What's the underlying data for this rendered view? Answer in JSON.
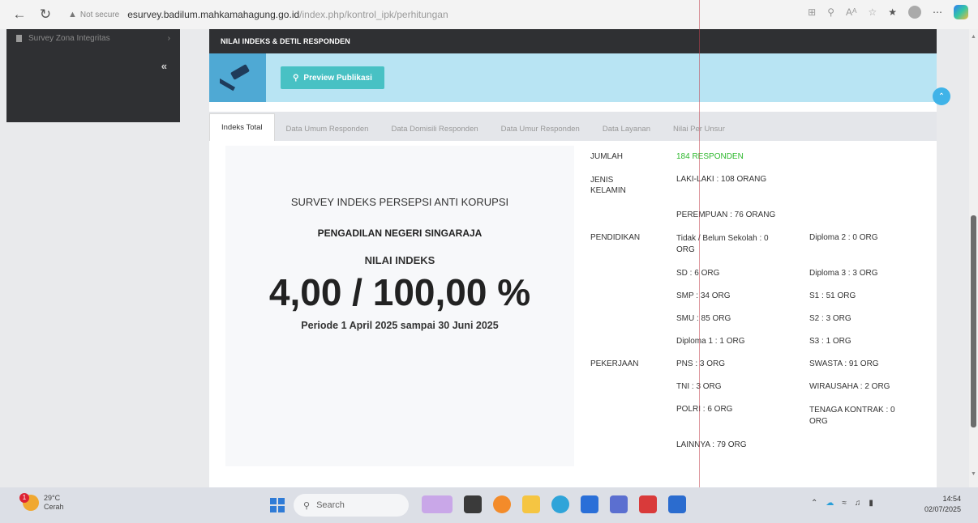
{
  "browser": {
    "security_label": "Not secure",
    "url_host": "esurvey.badilum.mahkamahagung.go.id",
    "url_path": "/index.php/kontrol_ipk/perhitungan",
    "aa_label": "Aᴬ"
  },
  "sidebar": {
    "item_label": "Survey Zona Integritas",
    "collapse_glyph": "«"
  },
  "panel": {
    "title": "NILAI INDEKS & DETIL RESPONDEN",
    "preview_button": "Preview Publikasi"
  },
  "tabs": [
    {
      "label": "Indeks Total",
      "active": true
    },
    {
      "label": "Data Umum Responden",
      "active": false
    },
    {
      "label": "Data Domisili Responden",
      "active": false
    },
    {
      "label": "Data Umur Responden",
      "active": false
    },
    {
      "label": "Data Layanan",
      "active": false
    },
    {
      "label": "Nilai Per Unsur",
      "active": false
    }
  ],
  "index_card": {
    "survey_title": "SURVEY INDEKS PERSEPSI ANTI KORUPSI",
    "court": "PENGADILAN NEGERI SINGARAJA",
    "nilai_label": "NILAI INDEKS",
    "value": "4,00 / 100,00 %",
    "period": "Periode 1 April 2025 sampai 30 Juni 2025"
  },
  "details": {
    "jumlah_label": "JUMLAH",
    "jumlah_value": "184 RESPONDEN",
    "jenis_label": "JENIS KELAMIN",
    "laki": "LAKI-LAKI : 108 ORANG",
    "perempuan": "PEREMPUAN : 76 ORANG",
    "pendidikan_label": "PENDIDIKAN",
    "pendidikan_left": [
      "Tidak / Belum Sekolah : 0 ORG",
      "SD : 6 ORG",
      "SMP : 34 ORG",
      "SMU : 85 ORG",
      "Diploma 1 : 1 ORG"
    ],
    "pendidikan_right": [
      "Diploma 2 : 0 ORG",
      "Diploma 3 : 3 ORG",
      "S1 : 51 ORG",
      "S2 : 3 ORG",
      "S3 : 1 ORG"
    ],
    "pekerjaan_label": "PEKERJAAN",
    "pekerjaan_left": [
      "PNS : 3 ORG",
      "TNI : 3 ORG",
      "POLRI : 6 ORG",
      "LAINNYA : 79 ORG"
    ],
    "pekerjaan_right": [
      "SWASTA : 91 ORG",
      "WIRAUSAHA : 2 ORG",
      "TENAGA KONTRAK : 0 ORG"
    ]
  },
  "taskbar": {
    "temperature": "29°C",
    "weather": "Cerah",
    "weather_badge": "1",
    "search_placeholder": "Search",
    "time": "14:54",
    "date": "02/07/2025"
  }
}
